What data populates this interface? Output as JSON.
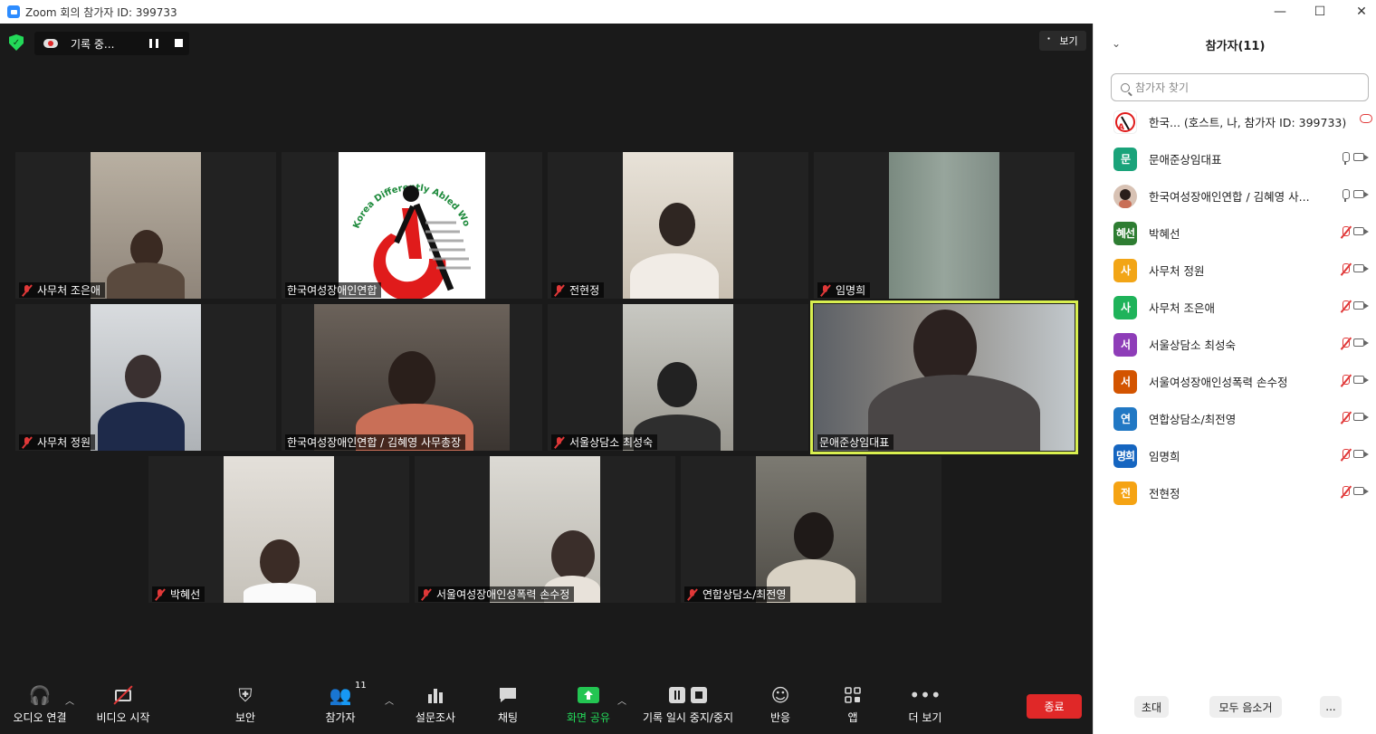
{
  "window": {
    "title": "Zoom 회의 참가자 ID: 399733",
    "minimize": "—",
    "maximize": "☐",
    "close": "✕"
  },
  "recording": {
    "label": "기록 중..."
  },
  "view_button": {
    "label": "보기"
  },
  "tiles": [
    {
      "name": "사무처 조은애",
      "muted": true
    },
    {
      "name": "한국여성장애인연합",
      "muted": false
    },
    {
      "name": "전현정",
      "muted": true
    },
    {
      "name": "임명희",
      "muted": true
    },
    {
      "name": "사무처 정원",
      "muted": true
    },
    {
      "name": "한국여성장애인연합 / 김혜영 사무총장",
      "muted": false
    },
    {
      "name": "서울상담소  최성숙",
      "muted": true
    },
    {
      "name": "문애준상임대표",
      "muted": false
    },
    {
      "name": "박혜선",
      "muted": true
    },
    {
      "name": "서울여성장애인성폭력 손수정",
      "muted": true
    },
    {
      "name": "연합상담소/최전영",
      "muted": true
    }
  ],
  "logo": {
    "text": "Korea Differently Abled Women United"
  },
  "toolbar": {
    "audio": "오디오 연결",
    "video": "비디오 시작",
    "security": "보안",
    "participants": "참가자",
    "participants_count": "11",
    "polls": "설문조사",
    "chat": "채팅",
    "share": "화면 공유",
    "record": "기록 일시 중지/중지",
    "reactions": "반응",
    "apps": "앱",
    "more": "더 보기",
    "end": "종료"
  },
  "panel": {
    "title": "참가자(11)",
    "search_placeholder": "참가자 찾기",
    "participants": [
      {
        "avatar": "",
        "name": "한국...  (호스트, 나, 참가자 ID: 399733)",
        "color": "#ffffff",
        "status": "rec"
      },
      {
        "avatar": "문",
        "name": "문애준상임대표",
        "color": "#1aa37a",
        "status": "mic"
      },
      {
        "avatar": "",
        "name": "한국여성장애인연합 / 김혜영 사...",
        "color": "#caa08a",
        "status": "mic"
      },
      {
        "avatar": "혜선",
        "name": "박혜선",
        "color": "#2e7d32",
        "status": "micoff"
      },
      {
        "avatar": "사",
        "name": "사무처 정원",
        "color": "#f2a516",
        "status": "micoff"
      },
      {
        "avatar": "사",
        "name": "사무처 조은애",
        "color": "#1fb35a",
        "status": "micoff"
      },
      {
        "avatar": "서",
        "name": "서울상담소  최성숙",
        "color": "#8e3db8",
        "status": "micoff"
      },
      {
        "avatar": "서",
        "name": "서울여성장애인성폭력 손수정",
        "color": "#d35400",
        "status": "micoff"
      },
      {
        "avatar": "연",
        "name": "연합상담소/최전영",
        "color": "#2178c4",
        "status": "micoff"
      },
      {
        "avatar": "명희",
        "name": "임명희",
        "color": "#1565c0",
        "status": "micoff"
      },
      {
        "avatar": "전",
        "name": "전현정",
        "color": "#f5a313",
        "status": "micoff"
      }
    ],
    "invite": "초대",
    "mute_all": "모두 음소거",
    "more": "..."
  }
}
